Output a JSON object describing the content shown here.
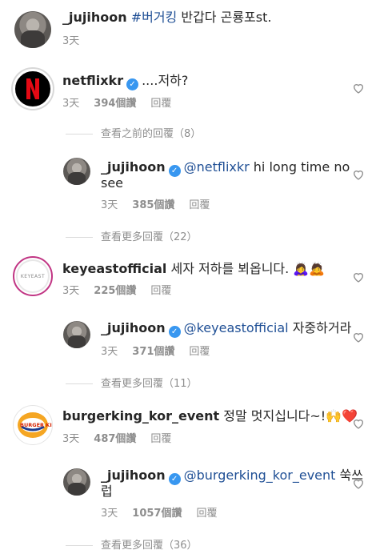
{
  "post": {
    "username": "_jujihoon",
    "hashtag": "#버거킹",
    "text": " 반갑다 곤룡포st.",
    "time": "3天"
  },
  "comments": [
    {
      "username": "netflixkr",
      "text": "....저하?",
      "time": "3天",
      "likes": "394個讚",
      "reply": "回覆",
      "view_more": "查看之前的回覆（8）",
      "avatar_icon": "netflix-logo-icon"
    },
    {
      "username": "_jujihoon",
      "mention": "@netflixkr",
      "text": " hi long time no",
      "text2": "see",
      "time": "3天",
      "likes": "385個讚",
      "reply": "回覆",
      "view_more": "查看更多回覆（22）"
    },
    {
      "username": "keyeastofficial",
      "text": "세자 저하를 뵈옵니다. 🙇‍♀️🙇",
      "time": "3天",
      "likes": "225個讚",
      "reply": "回覆",
      "avatar_label": "KEYEAST"
    },
    {
      "username": "_jujihoon",
      "mention": "@keyeastofficial",
      "text": "  자중하거라",
      "time": "3天",
      "likes": "371個讚",
      "reply": "回覆",
      "view_more": "查看更多回覆（11）"
    },
    {
      "username": "burgerking_kor_event",
      "text": "정말 멋지십니다~!🙌❤️",
      "time": "3天",
      "likes": "487個讚",
      "reply": "回覆",
      "avatar_label": "BURGER KING"
    },
    {
      "username": "_jujihoon",
      "mention": "@burgerking_kor_event",
      "text": " 쑥쓰",
      "text2": "럽",
      "time": "3天",
      "likes": "1057個讚",
      "reply": "回覆",
      "view_more": "查看更多回覆（36）"
    }
  ],
  "colors": {
    "verified": "#3897f0",
    "mention": "#1f4f95",
    "meta": "#8e8e8e",
    "netflix_red": "#e50914",
    "burgerking_red": "#d62300",
    "burgerking_orange": "#f5a623"
  },
  "icons": {
    "like": "heart-outline-icon",
    "verified": "verified-badge-icon"
  }
}
